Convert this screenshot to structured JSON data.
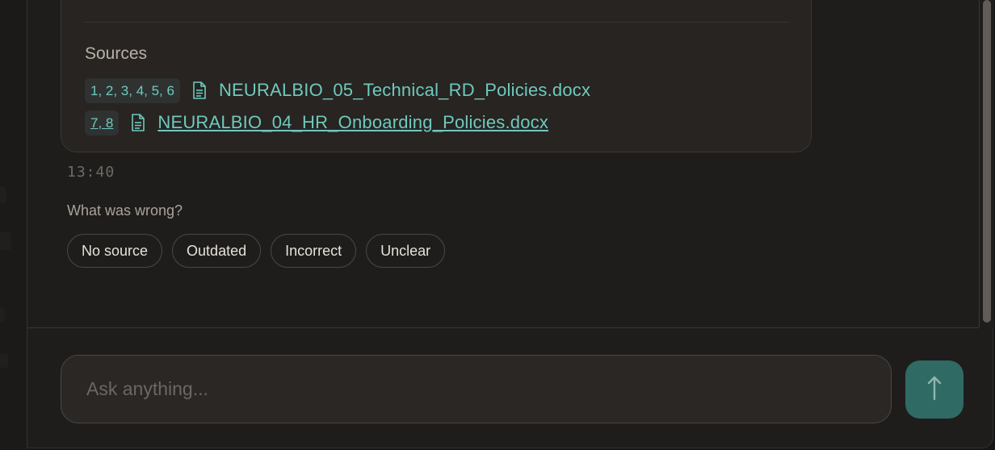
{
  "sources": {
    "title": "Sources",
    "items": [
      {
        "refs": "1, 2, 3, 4, 5, 6",
        "file": "NEURALBIO_05_Technical_RD_Policies.docx"
      },
      {
        "refs": "7, 8",
        "file": "NEURALBIO_04_HR_Onboarding_Policies.docx"
      }
    ]
  },
  "message": {
    "timestamp": "13:40"
  },
  "feedback": {
    "question": "What was wrong?",
    "options": [
      "No source",
      "Outdated",
      "Incorrect",
      "Unclear"
    ]
  },
  "composer": {
    "placeholder": "Ask anything...",
    "value": ""
  },
  "colors": {
    "accent": "#6fc9bd",
    "send_button": "#2f6b64"
  },
  "icons": {
    "source_file": "document-icon",
    "send": "arrow-up-icon"
  }
}
